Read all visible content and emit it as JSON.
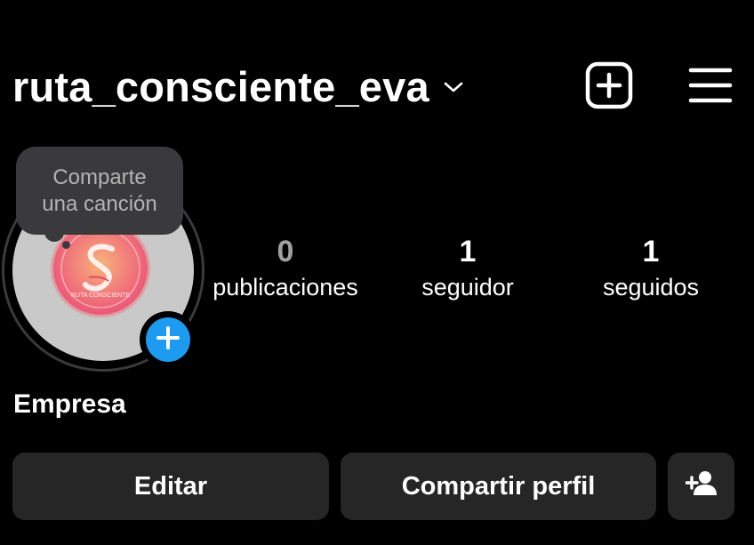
{
  "header": {
    "username": "ruta_consciente_eva",
    "chevron_icon": "chevron-down-icon",
    "new_post_icon": "plus-square-icon",
    "menu_icon": "hamburger-menu-icon"
  },
  "note": {
    "line1": "Comparte",
    "line2": "una canción"
  },
  "avatar": {
    "logo_text": "RUTA CONSCIENTE",
    "add_story_icon": "plus-icon",
    "add_story_color": "#1d9bf0"
  },
  "stats": {
    "posts": {
      "value": "0",
      "label": "publicaciones"
    },
    "followers": {
      "value": "1",
      "label": "seguidor"
    },
    "following": {
      "value": "1",
      "label": "seguidos"
    }
  },
  "category": "Empresa",
  "buttons": {
    "edit": "Editar",
    "share": "Compartir perfil",
    "add_person_icon": "add-person-icon"
  },
  "colors": {
    "background": "#000000",
    "button_bg": "#262626",
    "note_bg": "#3a3a3c",
    "accent": "#1d9bf0"
  }
}
